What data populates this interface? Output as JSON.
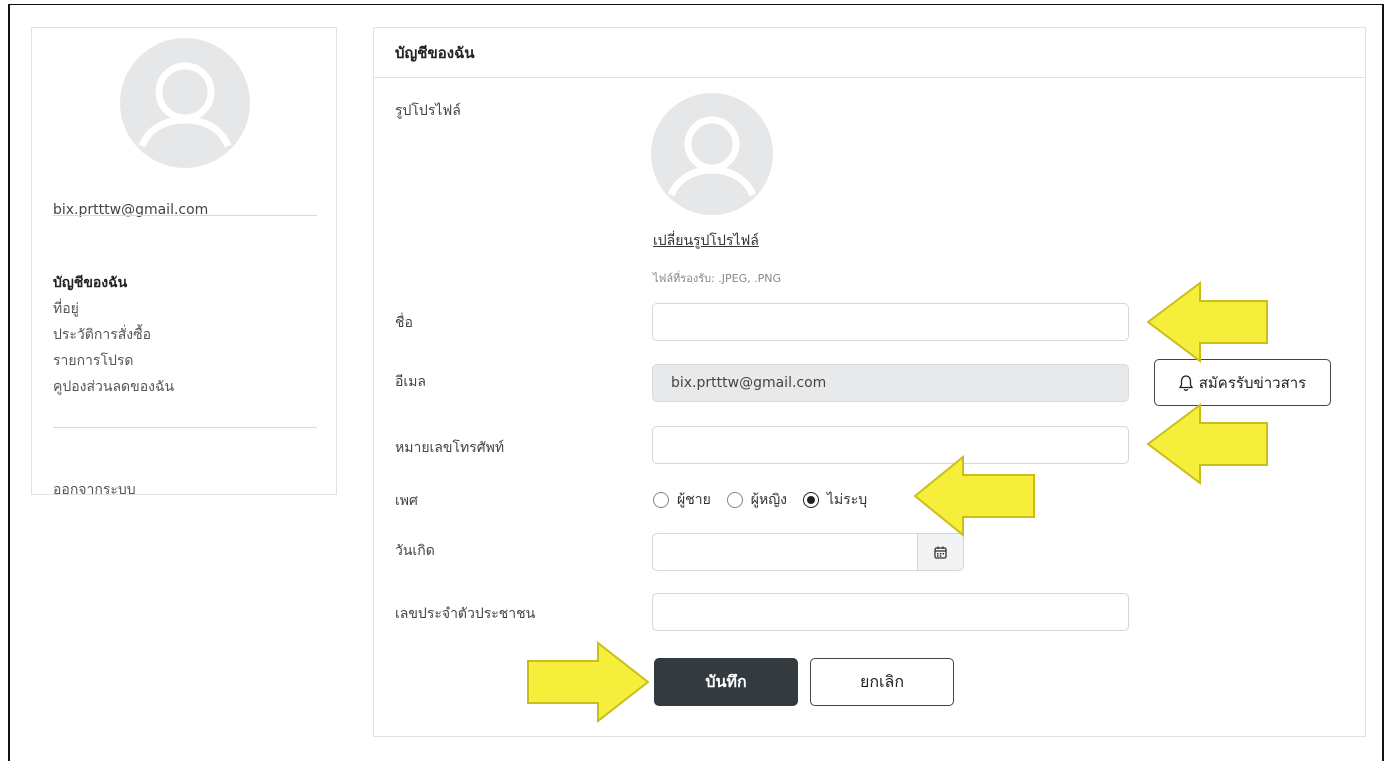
{
  "sidebar": {
    "avatar_icon": "user-avatar-icon",
    "email": "bix.prtttw@gmail.com",
    "menu": [
      {
        "label": "บัญชีของฉัน",
        "active": true
      },
      {
        "label": "ที่อยู่",
        "active": false
      },
      {
        "label": "ประวัติการสั่งซื้อ",
        "active": false
      },
      {
        "label": "รายการโปรด",
        "active": false
      },
      {
        "label": "คูปองส่วนลดของฉัน",
        "active": false
      }
    ],
    "logout_label": "ออกจากระบบ"
  },
  "main": {
    "title": "บัญชีของฉัน",
    "profile": {
      "label": "รูปโปรไฟล์",
      "change_link": "เปลี่ยนรูปโปรไฟล์",
      "file_hint": "ไฟล์ที่รองรับ: .JPEG, .PNG"
    },
    "fields": {
      "name": {
        "label": "ชื่อ",
        "value": ""
      },
      "email": {
        "label": "อีเมล",
        "value": "bix.prtttw@gmail.com"
      },
      "phone": {
        "label": "หมายเลขโทรศัพท์",
        "value": ""
      },
      "gender": {
        "label": "เพศ",
        "options": [
          "ผู้ชาย",
          "ผู้หญิง",
          "ไม่ระบุ"
        ],
        "selected": "ไม่ระบุ"
      },
      "birthday": {
        "label": "วันเกิด",
        "value": ""
      },
      "national_id": {
        "label": "เลขประจำตัวประชาชน",
        "value": ""
      }
    },
    "subscribe_label": "สมัครรับข่าวสาร",
    "save_label": "บันทึก",
    "cancel_label": "ยกเลิก"
  },
  "colors": {
    "arrow_fill": "#f5ee3a",
    "arrow_stroke": "#c9be1a",
    "save_bg": "#333a40",
    "disabled_bg": "#e7e9eb",
    "avatar_bg": "#e5e7e9"
  }
}
